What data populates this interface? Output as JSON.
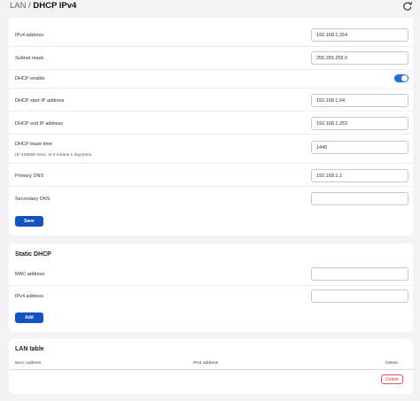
{
  "header": {
    "breadcrumb_root": "LAN",
    "separator": "/",
    "title": "DHCP IPv4",
    "refresh_icon": "refresh-icon"
  },
  "lan": {
    "fields": [
      {
        "label": "IPv4 address",
        "value": "192.168.1.254"
      },
      {
        "label": "Subnet mask",
        "value": "255.255.255.0"
      },
      {
        "label": "DHCP enable",
        "toggle_on": true
      },
      {
        "label": "DHCP start IP address",
        "value": "192.168.1.64"
      },
      {
        "label": "DHCP end IP address",
        "value": "192.168.1.253"
      },
      {
        "label": "DHCP lease time",
        "hint": "(5~129600 mins, or 0 means 1 day)mins.",
        "value": "1440"
      },
      {
        "label": "Primary DNS",
        "value": "192.168.1.1"
      },
      {
        "label": "Secondary DNS",
        "value": ""
      }
    ],
    "save_label": "Save"
  },
  "static_dhcp": {
    "title": "Static DHCP",
    "fields": [
      {
        "label": "MAC address",
        "value": ""
      },
      {
        "label": "IPv4 address",
        "value": ""
      }
    ],
    "add_label": "Add"
  },
  "lan_table": {
    "title": "LAN table",
    "columns": [
      "MAC Address",
      "IPv4 address",
      "Delete"
    ],
    "delete_label": "Delete"
  },
  "colors": {
    "primary": "#1452c2",
    "toggle_on": "#1f6fd8",
    "danger": "#d23c3c"
  }
}
